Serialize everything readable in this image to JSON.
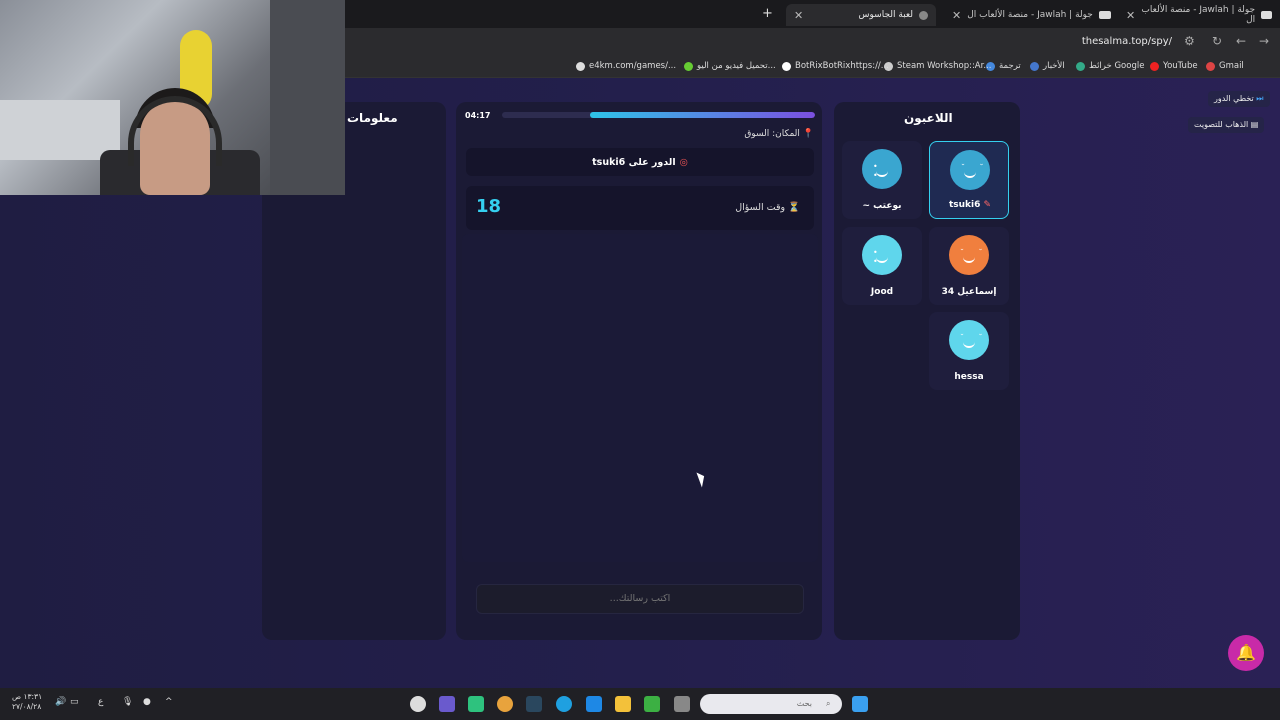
{
  "browser": {
    "tabs": [
      {
        "title": "جولة | Jawlah - منصة الألعاب ال",
        "active": false
      },
      {
        "title": "جولة | Jawlah - منصة الألعاب ال",
        "active": false
      },
      {
        "title": "لعبة الجاسوس",
        "active": true
      }
    ],
    "new_tab": "+",
    "close": "✕",
    "url": "thesalma.top/spy/",
    "bookmarks": [
      "Gmail",
      "YouTube",
      "خرائط Google",
      "الأخبار",
      "ترجمة",
      "Steam Workshop::Ar...",
      "BotRixBotRixhttps://...",
      "تحميل فيديو من اليو...",
      "e4km.com/games/..."
    ]
  },
  "game": {
    "info_title": "معلومات",
    "players_title": "اللاعبون",
    "timer": "04:17",
    "time_progress": 0.72,
    "location": "المكان: السوق",
    "turn": "الدور على tsuki6",
    "question_time_label": "وقت السؤال",
    "question_time_value": "18",
    "message_placeholder": "اكتب رسالتك...",
    "skip_turn": "تخطي الدور",
    "go_vote": "الذهاب للتصويت",
    "players": [
      {
        "name": "tsuki6",
        "color": "#3aa6d0",
        "selected": true
      },
      {
        "name": "بوعتب ~",
        "color": "#3aa6d0",
        "selected": false
      },
      {
        "name": "إسماعيل 34",
        "color": "#f07f3e",
        "selected": false
      },
      {
        "name": "Jood",
        "color": "#5fd6ec",
        "selected": false
      },
      {
        "name": "hessa",
        "color": "#5fd6ec",
        "selected": false
      }
    ]
  },
  "taskbar": {
    "search_placeholder": "بحث",
    "clock_time": "١٣:٣١ ص",
    "clock_date": "٢٧/٠٨/٢٨"
  }
}
